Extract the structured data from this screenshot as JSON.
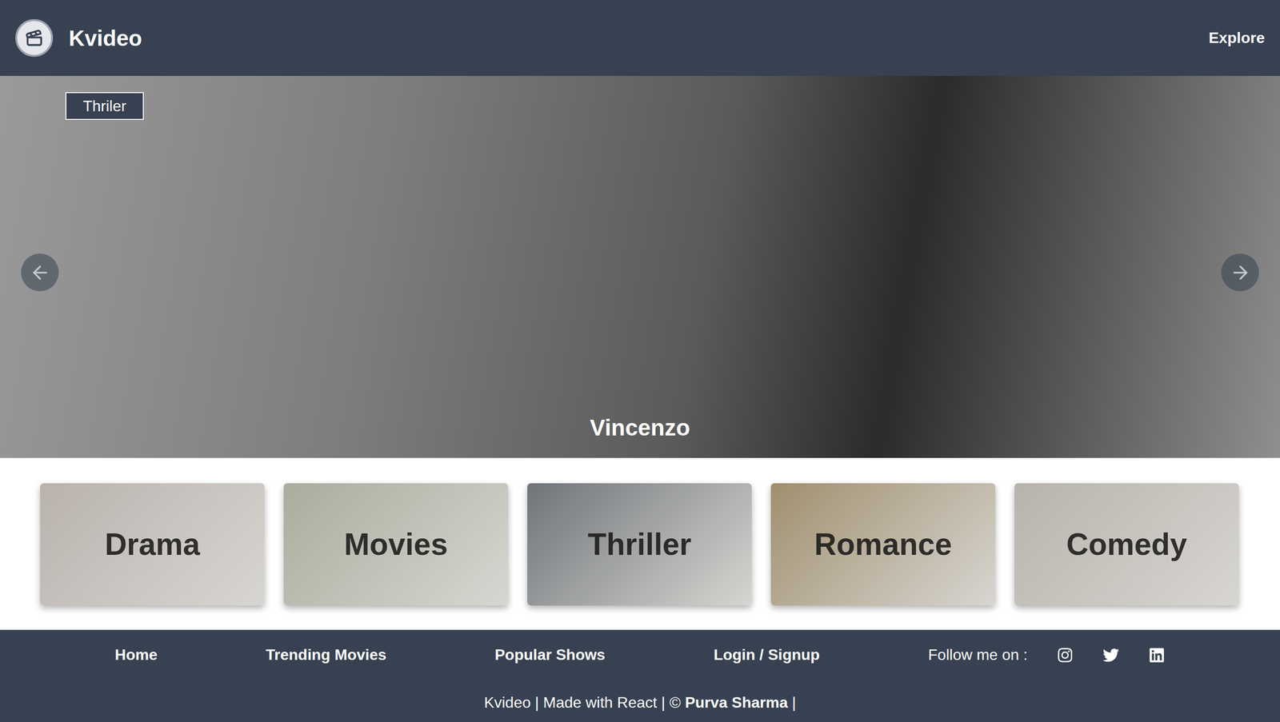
{
  "header": {
    "title": "Kvideo",
    "nav": [
      "Explore"
    ]
  },
  "hero": {
    "badge": "Thriler",
    "title": "Vincenzo"
  },
  "categories": [
    {
      "label": "Drama",
      "color": "#b9b2ad"
    },
    {
      "label": "Movies",
      "color": "#a9ad9c"
    },
    {
      "label": "Thriller",
      "color": "#6f7479"
    },
    {
      "label": "Romance",
      "color": "#a08f6e"
    },
    {
      "label": "Comedy",
      "color": "#b7b3ac"
    }
  ],
  "footer": {
    "links": [
      "Home",
      "Trending Movies",
      "Popular Shows",
      "Login / Signup"
    ],
    "follow": "Follow me on :",
    "credit": {
      "prefix": "Kvideo | Made with React | ©",
      "author": "Purva Sharma",
      "suffix": "|"
    }
  }
}
